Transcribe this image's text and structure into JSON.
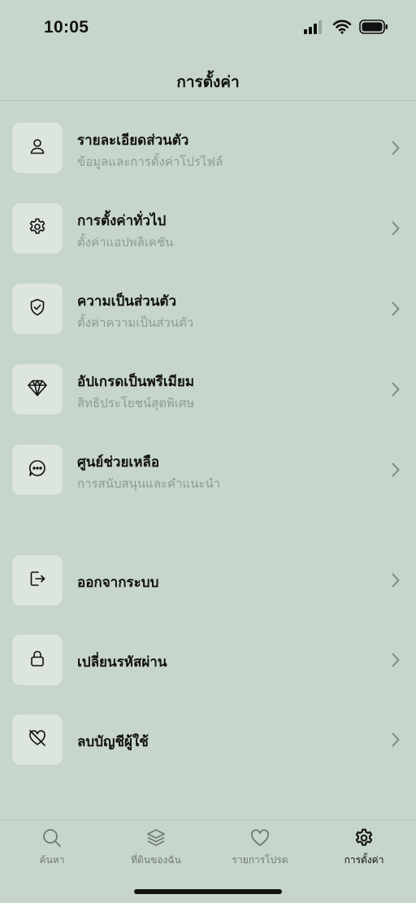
{
  "status_bar": {
    "time": "10:05",
    "icons": [
      "signal-icon",
      "wifi-icon",
      "battery-icon"
    ]
  },
  "header": {
    "title": "การตั้งค่า"
  },
  "menu": [
    {
      "id": "profile",
      "title": "รายละเอียดส่วนตัว",
      "subtitle": "ข้อมูลและการตั้งค่าโปรไฟล์",
      "icon": "person-icon"
    },
    {
      "id": "general",
      "title": "การตั้งค่าทั่วไป",
      "subtitle": "ตั้งค่าแอปพลิเคชัน",
      "icon": "gear-icon"
    },
    {
      "id": "privacy",
      "title": "ความเป็นส่วนตัว",
      "subtitle": "ตั้งค่าความเป็นส่วนตัว",
      "icon": "shield-check-icon"
    },
    {
      "id": "premium",
      "title": "อัปเกรดเป็นพรีเมียม",
      "subtitle": "สิทธิประโยชน์สุดพิเศษ",
      "icon": "diamond-icon"
    },
    {
      "id": "help",
      "title": "ศูนย์ช่วยเหลือ",
      "subtitle": "การสนับสนุนและคำแนะนำ",
      "icon": "chat-bubble-icon"
    }
  ],
  "account": [
    {
      "id": "logout",
      "title": "ออกจากระบบ",
      "icon": "logout-icon"
    },
    {
      "id": "password",
      "title": "เปลี่ยนรหัสผ่าน",
      "icon": "lock-icon"
    },
    {
      "id": "delete",
      "title": "ลบบัญชีผู้ใช้",
      "icon": "heart-off-icon"
    }
  ],
  "tabbar": [
    {
      "id": "search",
      "label": "ค้นหา",
      "icon": "search-icon",
      "active": false
    },
    {
      "id": "my-land",
      "label": "ที่ดินของฉัน",
      "icon": "layers-icon",
      "active": false
    },
    {
      "id": "favorites",
      "label": "รายการโปรด",
      "icon": "heart-icon",
      "active": false
    },
    {
      "id": "settings",
      "label": "การตั้งค่า",
      "icon": "gear-icon",
      "active": true
    }
  ],
  "colors": {
    "background": "#c7d6ca",
    "tile": "#dce5de",
    "subtitle": "#8d9a90",
    "text": "#111111"
  }
}
